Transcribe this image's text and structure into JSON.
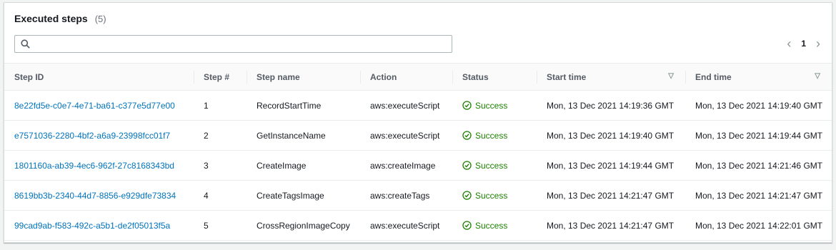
{
  "header": {
    "title": "Executed steps",
    "count": "(5)"
  },
  "search": {
    "placeholder": "",
    "value": ""
  },
  "pagination": {
    "current_page": "1",
    "prev_icon": "chevron-left-icon",
    "next_icon": "chevron-right-icon"
  },
  "table": {
    "columns": [
      "Step ID",
      "Step #",
      "Step name",
      "Action",
      "Status",
      "Start time",
      "End time"
    ],
    "rows": [
      {
        "step_id": "8e22fd5e-c0e7-4e71-ba61-c377e5d77e00",
        "step_num": "1",
        "step_name": "RecordStartTime",
        "action": "aws:executeScript",
        "status": "Success",
        "start_time": "Mon, 13 Dec 2021 14:19:36 GMT",
        "end_time": "Mon, 13 Dec 2021 14:19:40 GMT"
      },
      {
        "step_id": "e7571036-2280-4bf2-a6a9-23998fcc01f7",
        "step_num": "2",
        "step_name": "GetInstanceName",
        "action": "aws:executeScript",
        "status": "Success",
        "start_time": "Mon, 13 Dec 2021 14:19:40 GMT",
        "end_time": "Mon, 13 Dec 2021 14:19:44 GMT"
      },
      {
        "step_id": "1801160a-ab39-4ec6-962f-27c8168343bd",
        "step_num": "3",
        "step_name": "CreateImage",
        "action": "aws:createImage",
        "status": "Success",
        "start_time": "Mon, 13 Dec 2021 14:19:44 GMT",
        "end_time": "Mon, 13 Dec 2021 14:21:46 GMT"
      },
      {
        "step_id": "8619bb3b-2340-44d7-8856-e929dfe73834",
        "step_num": "4",
        "step_name": "CreateTagsImage",
        "action": "aws:createTags",
        "status": "Success",
        "start_time": "Mon, 13 Dec 2021 14:21:47 GMT",
        "end_time": "Mon, 13 Dec 2021 14:21:47 GMT"
      },
      {
        "step_id": "99cad9ab-f583-492c-a5b1-de2f05013f5a",
        "step_num": "5",
        "step_name": "CrossRegionImageCopy",
        "action": "aws:executeScript",
        "status": "Success",
        "start_time": "Mon, 13 Dec 2021 14:21:47 GMT",
        "end_time": "Mon, 13 Dec 2021 14:22:01 GMT"
      }
    ]
  },
  "colors": {
    "link": "#0073bb",
    "success": "#1d8102",
    "header_text": "#545b64"
  }
}
